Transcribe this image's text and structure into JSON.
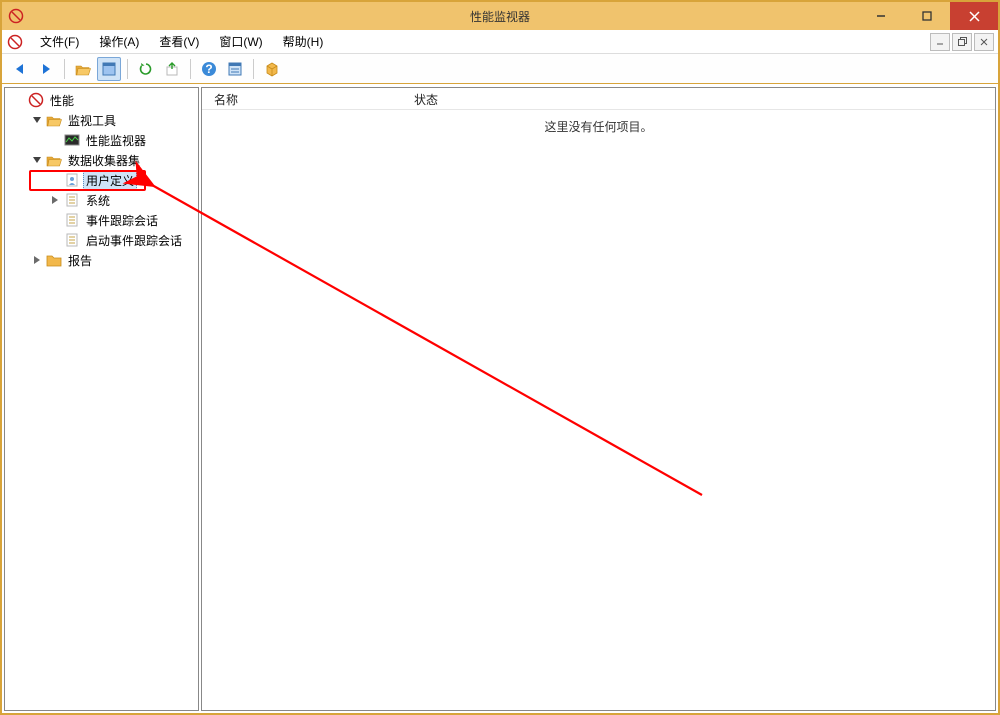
{
  "window": {
    "title": "性能监视器"
  },
  "menu": {
    "items": [
      "文件(F)",
      "操作(A)",
      "查看(V)",
      "窗口(W)",
      "帮助(H)"
    ]
  },
  "tree": {
    "root": "性能",
    "monitorTools": "监视工具",
    "perfMonitor": "性能监视器",
    "dataCollectors": "数据收集器集",
    "userDefined": "用户定义",
    "system": "系统",
    "eventTrace": "事件跟踪会话",
    "startupEventTrace": "启动事件跟踪会话",
    "reports": "报告"
  },
  "list": {
    "columns": {
      "name": "名称",
      "status": "状态"
    },
    "emptyMessage": "这里没有任何项目。"
  }
}
